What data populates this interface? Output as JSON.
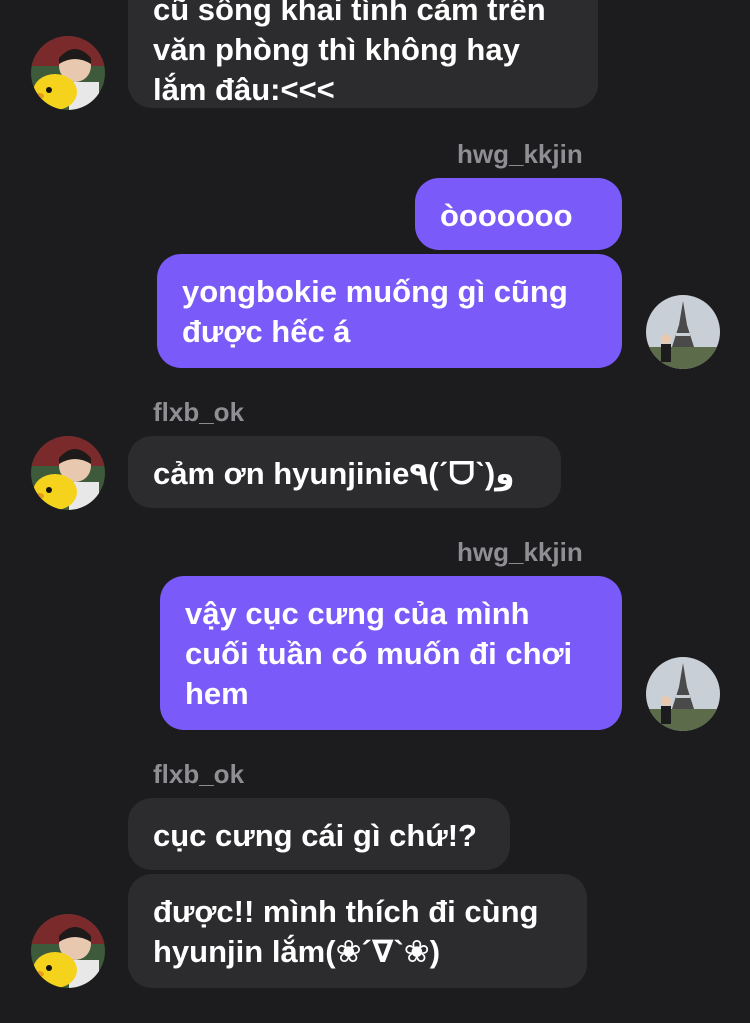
{
  "chat": {
    "messages": [
      {
        "sender": "",
        "direction": "incoming",
        "text": "cũ sống khai tình cảm trên\nvăn phòng thì không hay\nlắm đâu:<<<"
      },
      {
        "sender": "hwg_kkjin",
        "direction": "outgoing",
        "text": "òoooooo"
      },
      {
        "sender": "",
        "direction": "outgoing",
        "text": "yongbokie muống gì cũng\nđược hếc á"
      },
      {
        "sender": "flxb_ok",
        "direction": "incoming",
        "text": "cảm ơn hyunjinie٩(ˊᗜˋ)و"
      },
      {
        "sender": "hwg_kkjin",
        "direction": "outgoing",
        "text": "vậy cục cưng của mình\ncuối tuần có muốn đi chơi\nhem"
      },
      {
        "sender": "flxb_ok",
        "direction": "incoming",
        "text": "cục cưng cái gì chứ!?"
      },
      {
        "sender": "",
        "direction": "incoming",
        "text": "được!! mình thích đi cùng\nhyunjin lắm(❀´∇`❀)"
      }
    ]
  },
  "colors": {
    "background": "#1c1c1e",
    "incoming_bubble": "#2c2c2e",
    "outgoing_bubble": "#7a5af8",
    "sender_name": "#8e8e93"
  },
  "avatars": {
    "incoming": "duck-avatar-icon",
    "outgoing": "eiffel-tower-avatar-icon"
  }
}
